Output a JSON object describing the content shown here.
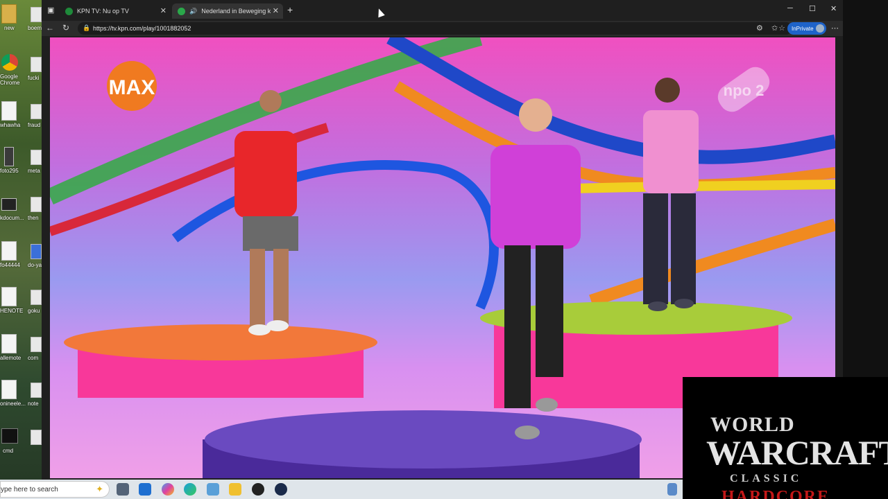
{
  "desktop": {
    "icons": [
      {
        "label": "new",
        "label2": "boem"
      },
      {
        "label": "Google Chrome",
        "label2": "fucki"
      },
      {
        "label": "whawha",
        "label2": "fraud"
      },
      {
        "label": "foto295",
        "label2": "meta"
      },
      {
        "label": "kdocum...",
        "label2": "then"
      },
      {
        "label": "fo44444",
        "label2": "do-ya"
      },
      {
        "label": "HENOTE",
        "label2": "goku"
      },
      {
        "label": "allemote",
        "label2": "com"
      },
      {
        "label": "onineele...",
        "label2": "note"
      },
      {
        "label": "cmd",
        "label2": ""
      }
    ]
  },
  "browser": {
    "tabs": [
      {
        "title": "KPN TV: Nu op TV",
        "favicon_color": "#1e8a3a",
        "icon": "kpn-favicon"
      },
      {
        "title": "Nederland in Beweging kijke",
        "favicon_color": "#2aa84a",
        "icon": "kpn-favicon"
      }
    ],
    "new_tab": "+",
    "address": "https://tv.kpn.com/play/1001882052",
    "inprivate": "InPrivate",
    "window_controls": {
      "minimize": "─",
      "maximize": "☐",
      "close": "✕"
    }
  },
  "video": {
    "channel_logo_left": "MAX",
    "channel_logo_right": "npo 2"
  },
  "overlay": {
    "line1": "WORLD",
    "line2": "WARCRAFT",
    "line3": "CLASSIC",
    "line4": "HARDCORE"
  },
  "taskbar": {
    "search_placeholder": "ype here to search",
    "apps": [
      "task-view-icon",
      "outlook-icon",
      "copilot-icon",
      "edge-icon",
      "files-icon",
      "explorer-icon",
      "app-icon",
      "wow-icon"
    ]
  }
}
